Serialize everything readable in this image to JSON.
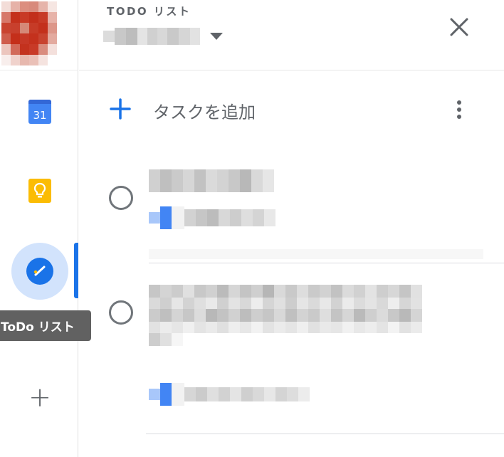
{
  "rail": {
    "calendar_date": "31",
    "tooltip": "ToDo リスト"
  },
  "panel": {
    "title": "TODO リスト",
    "add_task_label": "タスクを追加"
  },
  "colors": {
    "accent": "#1a73e8",
    "calendar": "#4285f4",
    "keep": "#fbbc04",
    "active_bg": "#d2e3fc",
    "tooltip_bg": "#616161"
  },
  "icons": {
    "close": "close-icon",
    "add": "plus-icon",
    "more": "more-vert-icon",
    "dropdown": "arrow-drop-down-icon"
  }
}
